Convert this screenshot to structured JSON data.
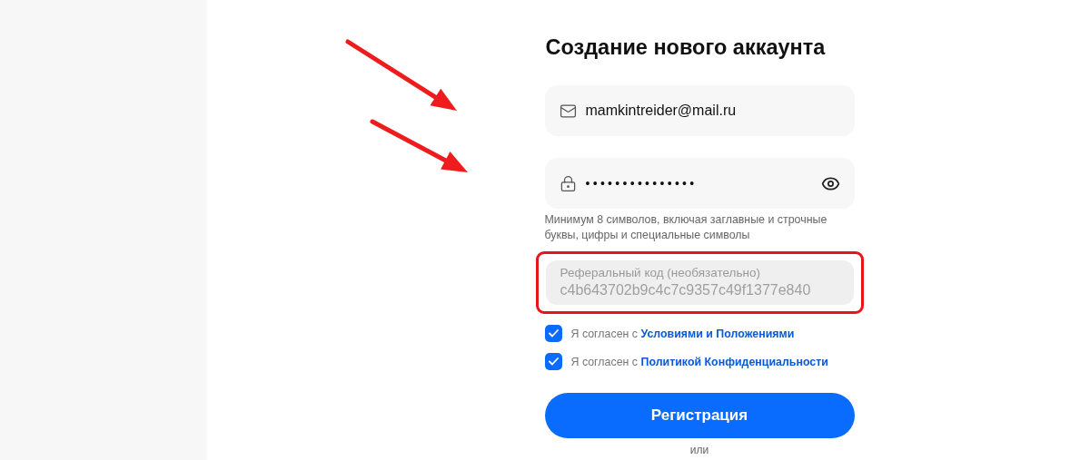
{
  "title": "Создание нового аккаунта",
  "email": {
    "value": "mamkintreider@mail.ru"
  },
  "password": {
    "value": "•••••••••••••••",
    "hint": "Минимум 8 символов, включая заглавные и строчные буквы, цифры и специальные символы"
  },
  "referral": {
    "label": "Реферальный код (необязательно)",
    "value": "c4b643702b9c4c7c9357c49f1377e840",
    "disabled": true,
    "highlighted": true
  },
  "agreements": [
    {
      "text": "Я согласен с",
      "link": "Условиями и Положениями",
      "checked": true
    },
    {
      "text": "Я согласен с",
      "link": "Политикой Конфиденциальности",
      "checked": true
    }
  ],
  "submit": "Регистрация",
  "divider": "или",
  "annotations": [
    {
      "kind": "arrow"
    },
    {
      "kind": "arrow"
    }
  ]
}
